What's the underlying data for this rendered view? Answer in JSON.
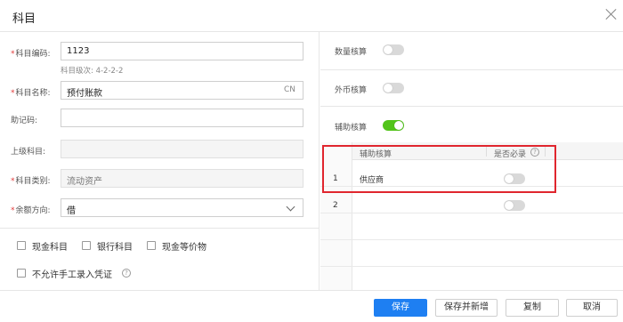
{
  "dialog": {
    "title": "科目"
  },
  "form": {
    "code": {
      "label": "科目编码:",
      "value": "1123",
      "hint": "科目级次: 4-2-2-2"
    },
    "name": {
      "label": "科目名称:",
      "value": "预付账款",
      "suffix": "CN"
    },
    "mnemonic": {
      "label": "助记码:",
      "value": ""
    },
    "parent": {
      "label": "上级科目:",
      "value": ""
    },
    "category": {
      "label": "科目类别:",
      "value": "流动资产"
    },
    "balance_direction": {
      "label": "余额方向:",
      "value": "借"
    },
    "required_mark": "*"
  },
  "checkboxes": {
    "cash_account": "现金科目",
    "bank_account": "银行科目",
    "cash_equivalent": "现金等价物",
    "no_manual_voucher": "不允许手工录入凭证",
    "help_icon": "?"
  },
  "right_panel": {
    "quantity_accounting": {
      "label": "数量核算",
      "enabled": false
    },
    "foreign_currency_accounting": {
      "label": "外币核算",
      "enabled": false
    },
    "auxiliary_accounting": {
      "label": "辅助核算",
      "enabled": true
    },
    "grid": {
      "columns": [
        "辅助核算",
        "是否必录"
      ],
      "help_icon": "?",
      "rows": [
        {
          "index": "1",
          "auxiliary": "供应商",
          "required": false
        },
        {
          "index": "2",
          "auxiliary": "",
          "required": false
        }
      ]
    }
  },
  "footer": {
    "save": "保存",
    "save_and_new": "保存并新增",
    "copy": "复制",
    "cancel": "取消"
  },
  "colors": {
    "primary": "#1e7ff2",
    "toggle_on": "#52c41a",
    "required": "#e23b3b",
    "highlight": "#e0262e"
  }
}
